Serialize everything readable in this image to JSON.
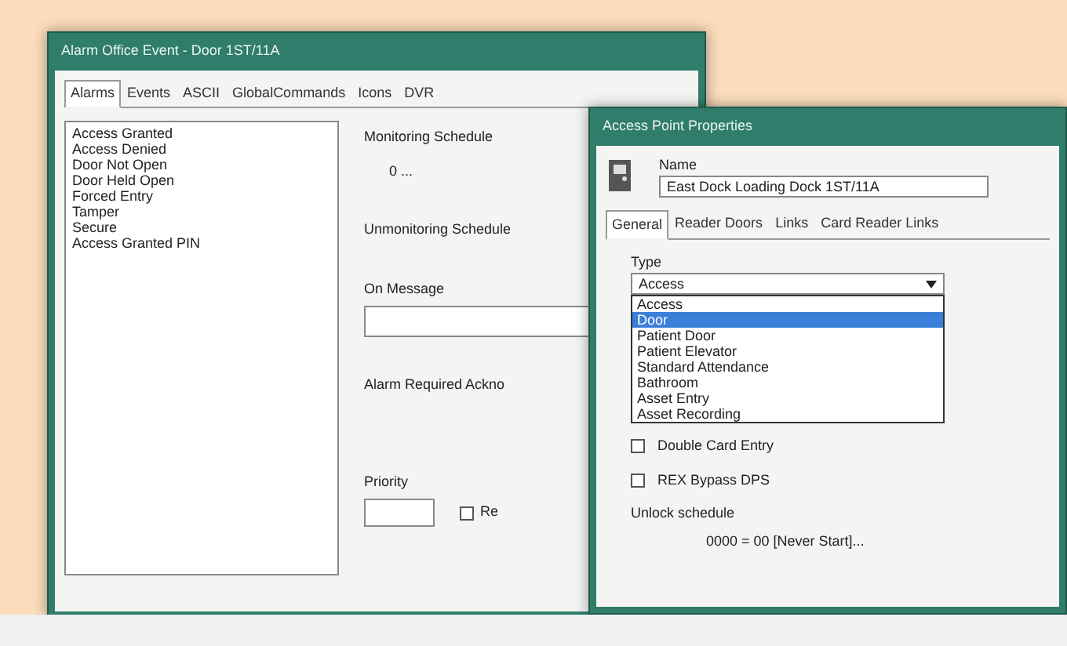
{
  "main_window": {
    "title": "Alarm Office Event - Door 1ST/11A",
    "tabs": [
      {
        "label": "Alarms",
        "selected": true
      },
      {
        "label": "Events",
        "selected": false
      },
      {
        "label": "ASCII",
        "selected": false
      },
      {
        "label": "GlobalCommands",
        "selected": false
      },
      {
        "label": "Icons",
        "selected": false
      },
      {
        "label": "DVR",
        "selected": false
      }
    ],
    "alarm_list": [
      "Access Granted",
      "Access Denied",
      "Door Not Open",
      "Door Held Open",
      "Forced Entry",
      "Tamper",
      "Secure",
      "Access Granted PIN"
    ],
    "monitoring_schedule": {
      "label": "Monitoring Schedule",
      "value": "0 ..."
    },
    "unmonitoring_schedule": {
      "label": "Unmonitoring Schedule"
    },
    "on_message": {
      "label": "On Message"
    },
    "ack_label": "Alarm Required Ackno",
    "priority": {
      "label": "Priority"
    },
    "checkbox": {
      "label": "Re",
      "checked": false
    }
  },
  "properties_window": {
    "title": "Access Point Properties",
    "name_label": "Name",
    "name_value": "East Dock Loading Dock 1ST/11A",
    "tabs": [
      {
        "label": "General",
        "selected": true
      },
      {
        "label": "Reader Doors",
        "selected": false
      },
      {
        "label": "Links",
        "selected": false
      },
      {
        "label": "Card Reader Links",
        "selected": false
      }
    ],
    "type_label": "Type",
    "type_value": "Access",
    "type_options": [
      {
        "label": "Access",
        "selected": false
      },
      {
        "label": "Door",
        "selected": true
      },
      {
        "label": "Patient Door",
        "selected": false
      },
      {
        "label": "Patient Elevator",
        "selected": false
      },
      {
        "label": "Standard Attendance",
        "selected": false
      },
      {
        "label": "Bathroom",
        "selected": false
      },
      {
        "label": "Asset Entry",
        "selected": false
      },
      {
        "label": "Asset Recording",
        "selected": false
      }
    ],
    "checkboxes": [
      {
        "label": "Double Card Entry",
        "checked": false
      },
      {
        "label": "REX Bypass DPS",
        "checked": false
      }
    ],
    "unlock_label": "Unlock schedule",
    "unlock_value": "0000 = 00 [Never Start]..."
  }
}
